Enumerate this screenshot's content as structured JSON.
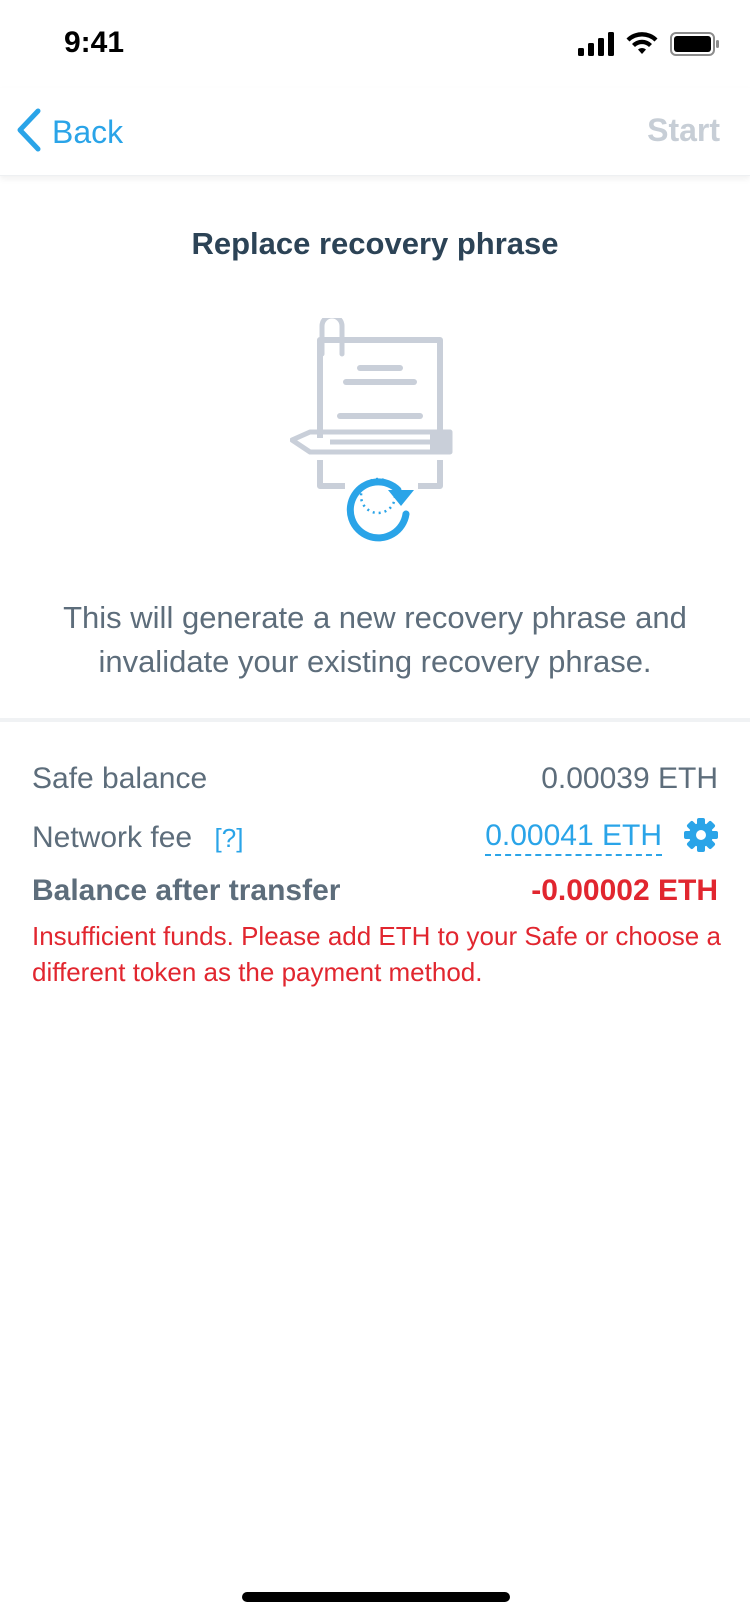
{
  "status_bar": {
    "time": "9:41"
  },
  "nav": {
    "back_label": "Back",
    "start_label": "Start"
  },
  "page": {
    "title": "Replace recovery phrase",
    "description": "This will generate a new recovery phrase and invalidate your existing recovery phrase."
  },
  "summary": {
    "safe_balance_label": "Safe balance",
    "safe_balance_value": "0.00039 ETH",
    "network_fee_label": "Network fee",
    "network_fee_help": "[?]",
    "network_fee_value": "0.00041 ETH",
    "balance_after_label": "Balance after transfer",
    "balance_after_value": "-0.00002 ETH",
    "error_message": "Insufficient funds. Please add ETH to your Safe or choose a different token as the payment method."
  },
  "colors": {
    "accent": "#2aa4e8",
    "error": "#e1262f",
    "text_primary": "#2c4356",
    "text_secondary": "#5d6d7b",
    "disabled": "#c7ced6"
  },
  "icons": {
    "back": "chevron-left-icon",
    "settings": "gear-icon",
    "illustration": "document-refresh-icon"
  }
}
